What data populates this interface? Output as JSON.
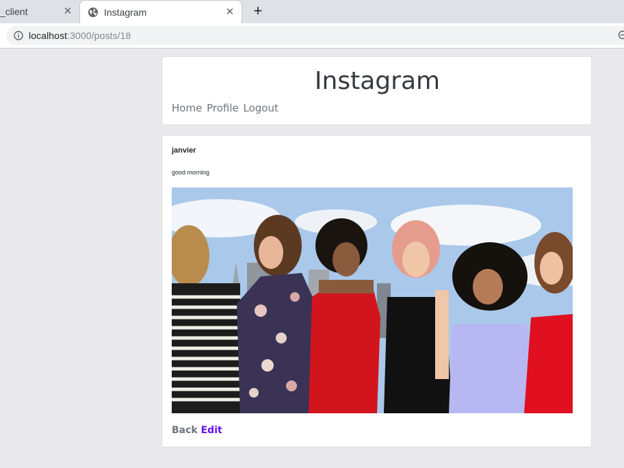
{
  "browser": {
    "tabs": [
      {
        "title": "_client",
        "close": "✕"
      },
      {
        "title": "Instagram",
        "close": "✕"
      }
    ],
    "new_tab": "+",
    "url_host": "localhost",
    "url_path": ":3000/posts/18"
  },
  "header": {
    "title": "Instagram",
    "nav": [
      "Home",
      "Profile",
      "Logout"
    ]
  },
  "post": {
    "author": "janvier",
    "caption": "good morning",
    "image_icon": "photo-of-group-of-women",
    "actions": {
      "back": "Back",
      "edit": "Edit"
    }
  },
  "colors": {
    "title": "#343a40",
    "nav": "#6c757d",
    "edit_link": "#6610f2",
    "page_bg": "#e9e9eb"
  }
}
